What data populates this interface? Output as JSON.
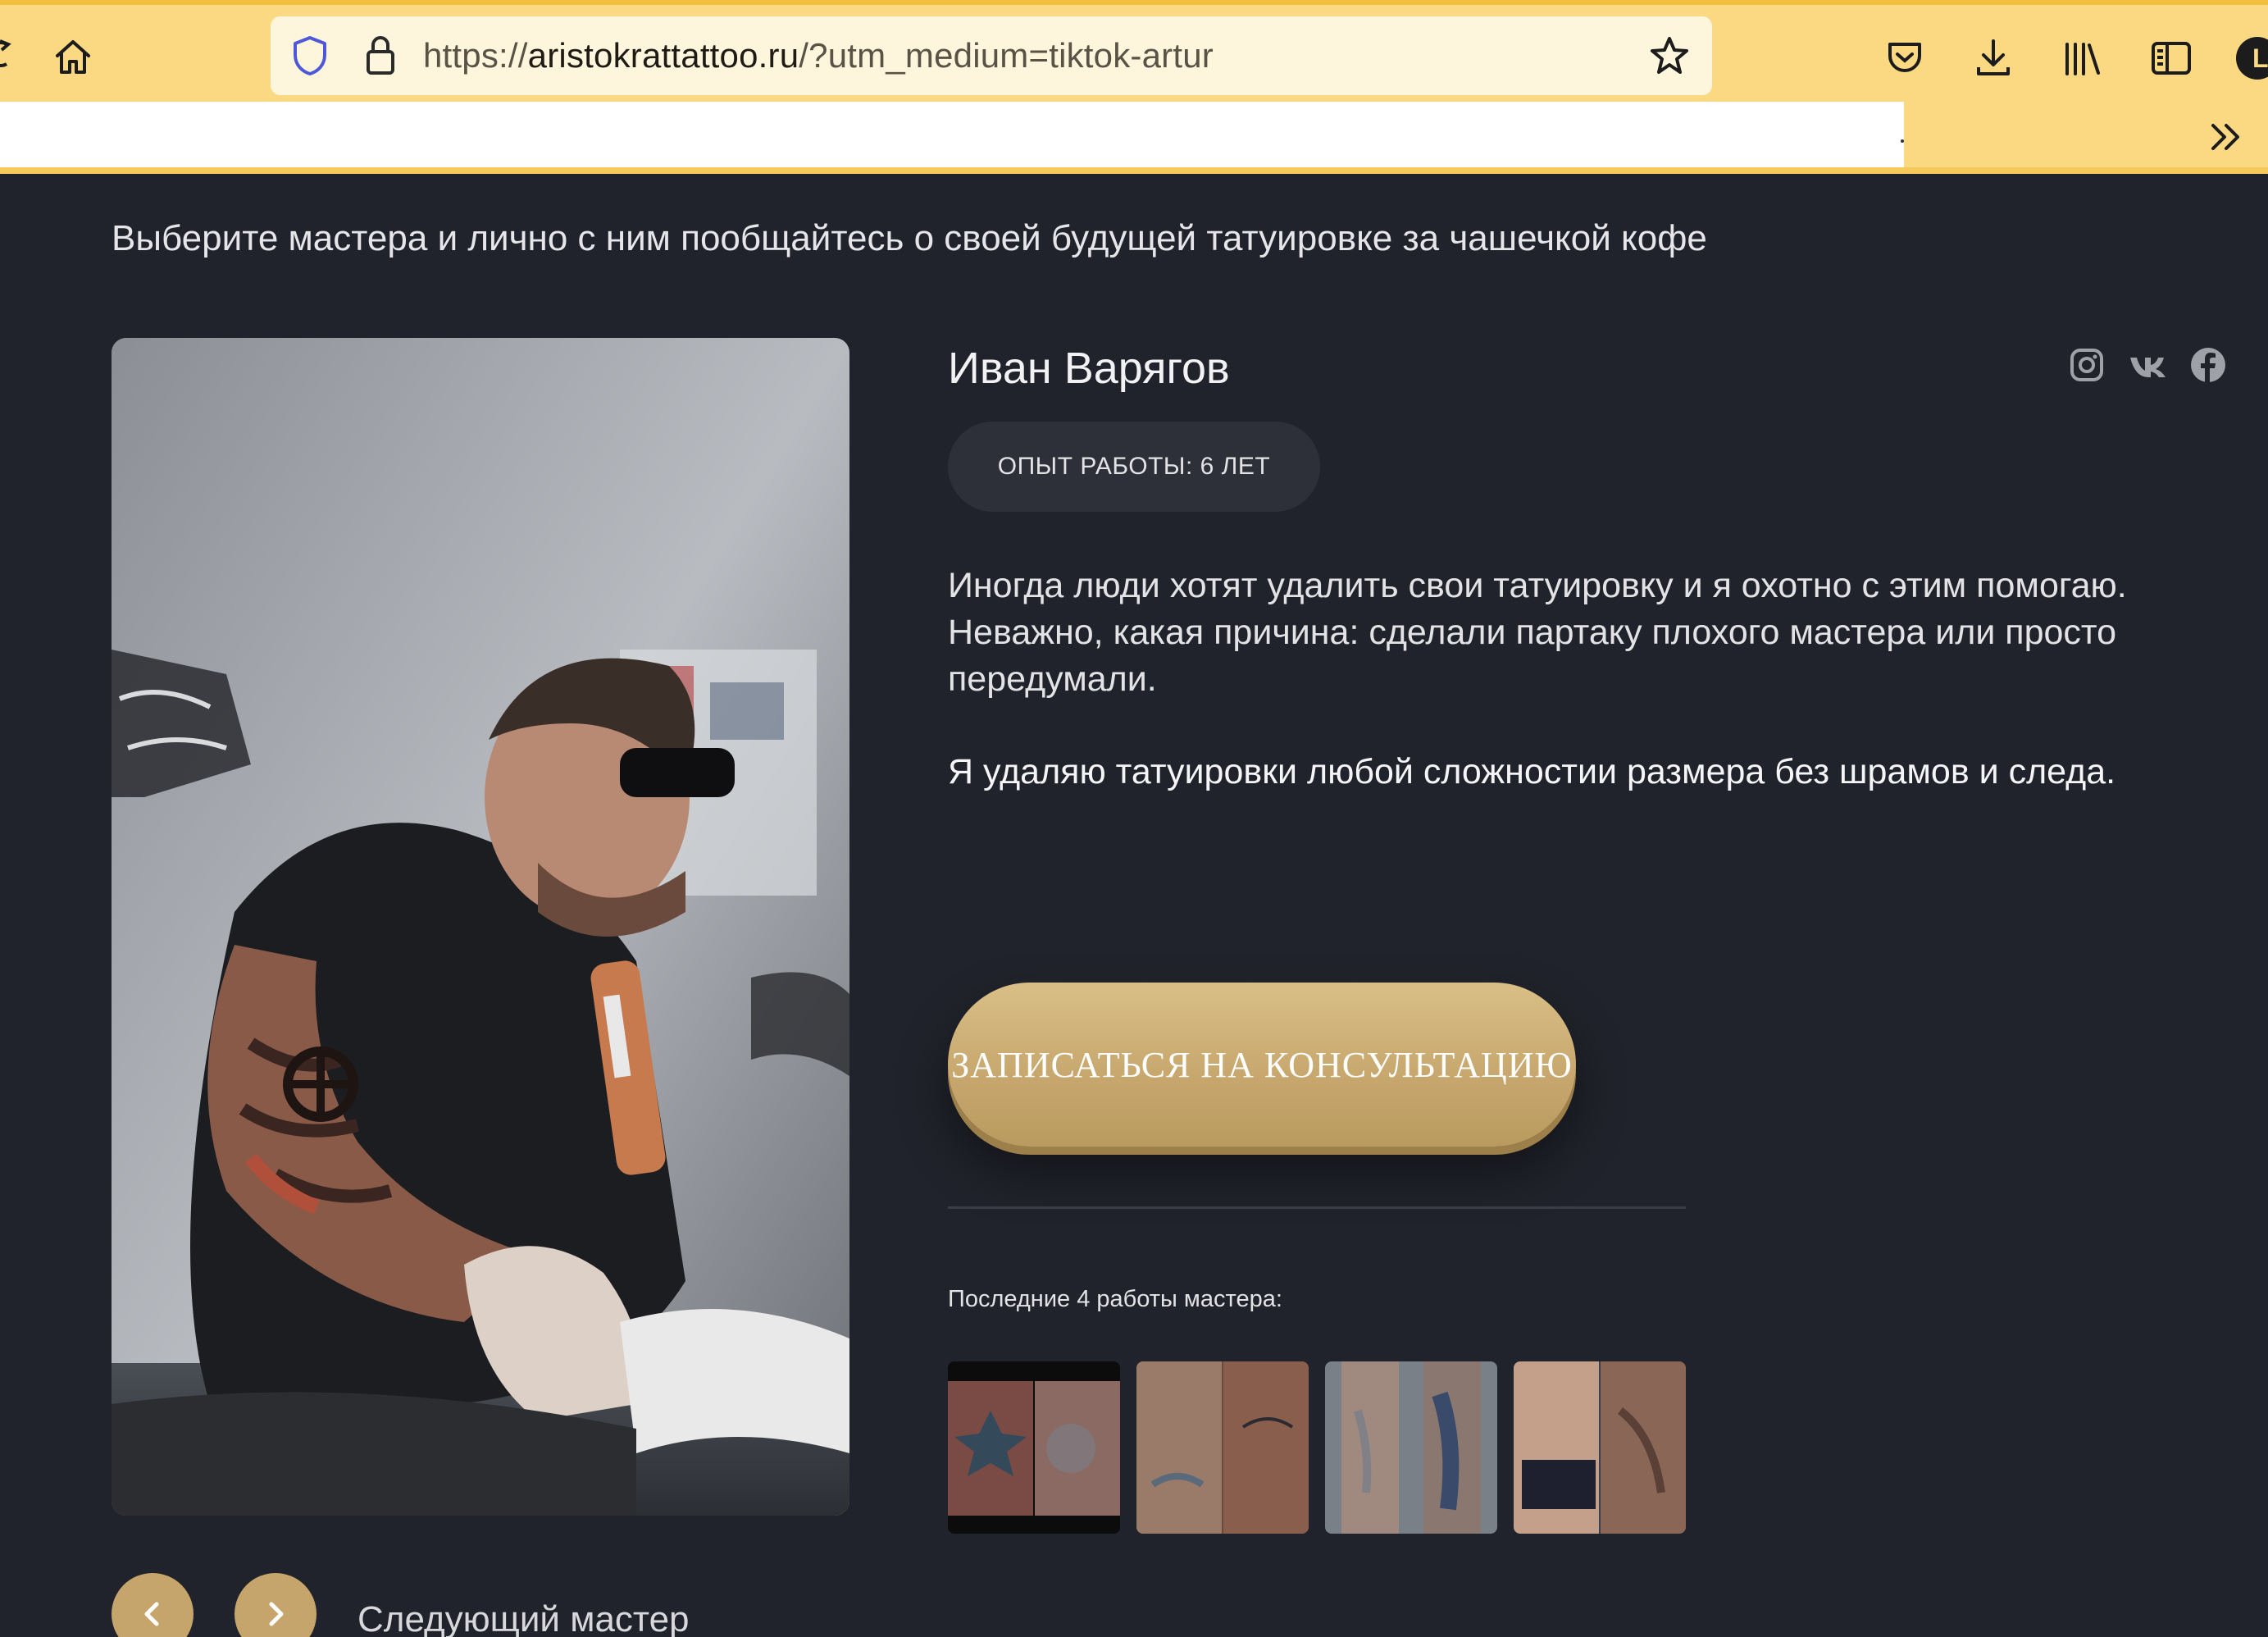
{
  "browser": {
    "url_scheme": "https://",
    "url_host": "aristokrattattoo.ru",
    "url_path": "/?utm_medium=tiktok-artur",
    "icons": [
      "reload-icon",
      "home-icon",
      "tracking-shield-icon",
      "lock-icon",
      "bookmark-star-icon",
      "pocket-icon",
      "download-icon",
      "library-icon",
      "sidebar-icon",
      "profile-icon",
      "overflow-chevron-icon"
    ]
  },
  "page": {
    "intro": "Выберите мастера и лично с ним пообщайтесь о своей будущей татуировке за чашечкой кофе"
  },
  "master": {
    "name": "Иван Варягов",
    "experience": "ОПЫТ РАБОТЫ: 6 ЛЕТ",
    "bio_line1": "Иногда люди хотят удалить свои татуировку и я охотно с этим помогаю. Неважно, какая причина: сделали партаку плохого мастера или просто передумали.",
    "bio_line2": "Я удаляю татуировки любой сложностии размера без шрамов и следа.",
    "socials": [
      "instagram-icon",
      "vk-icon",
      "facebook-icon"
    ]
  },
  "cta": {
    "label": "Записаться на консультацию"
  },
  "works": {
    "label": "Последние 4 работы мастера:",
    "count": 4
  },
  "navigation": {
    "next_label": "Следующий мастер"
  },
  "colors": {
    "toolbar": "#fad982",
    "page_background": "#20232b",
    "accent_gold": "#c5a56b"
  }
}
